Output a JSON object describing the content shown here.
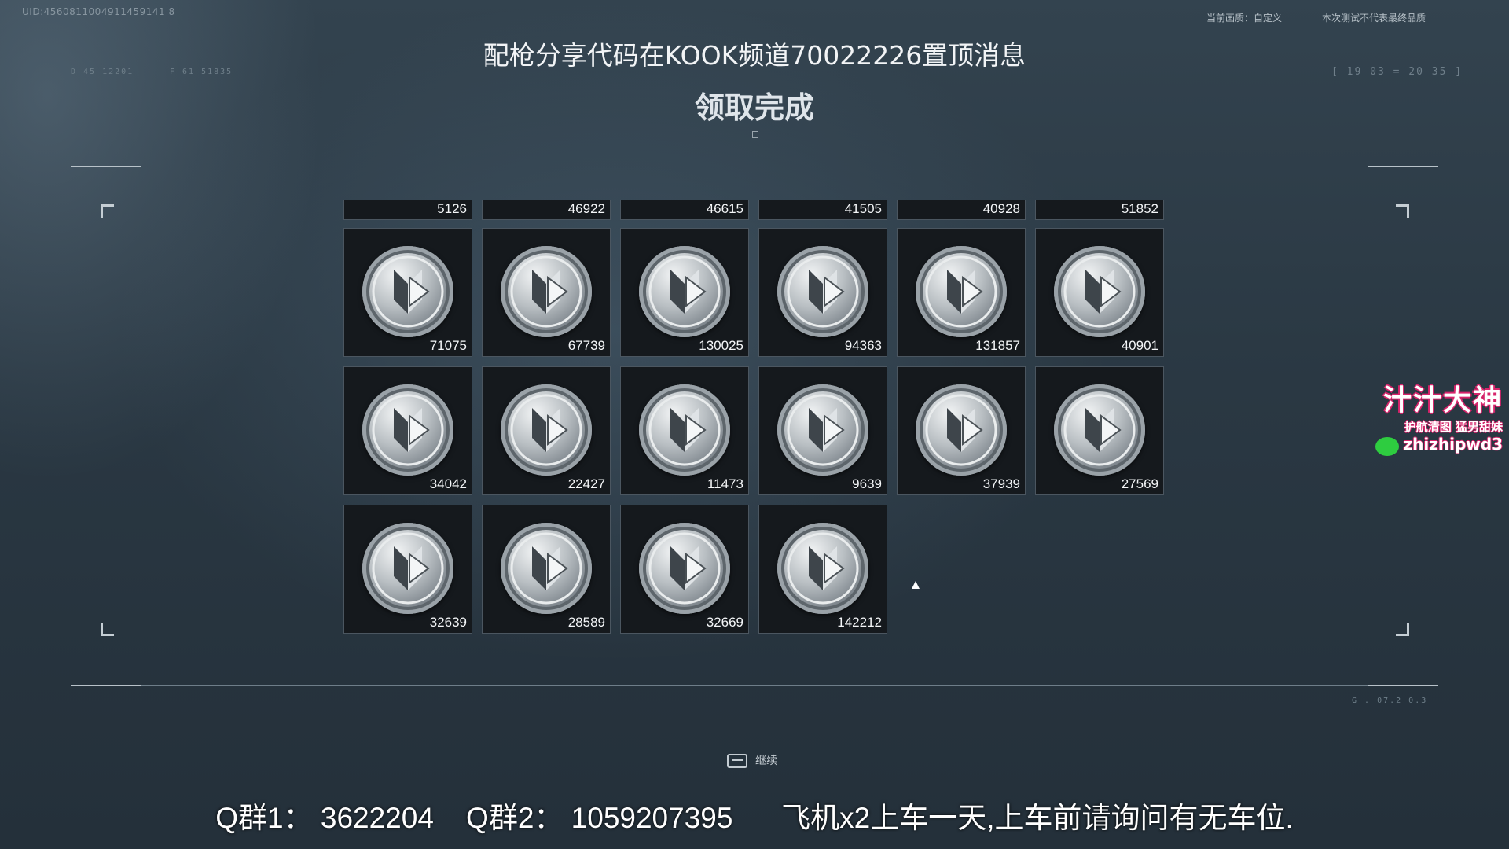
{
  "uid": "UID:4560811004911459141 8",
  "hud": {
    "top_left_a": "D 45  12201",
    "top_left_b": "F 61  51835",
    "top_right_bracket": "[ 19 03 = 20 35 ]",
    "bottom_right": "G  .  07.2     0.3"
  },
  "top_right": {
    "quality_label": "当前画质：自定义",
    "test_notice": "本次测试不代表最终品质"
  },
  "headline": "配枪分享代码在KOOK频道70022226置顶消息",
  "title": "领取完成",
  "stub_row": [
    "5126",
    "46922",
    "46615",
    "41505",
    "40928",
    "51852"
  ],
  "rows": [
    [
      "71075",
      "67739",
      "130025",
      "94363",
      "131857",
      "40901"
    ],
    [
      "34042",
      "22427",
      "11473",
      "9639",
      "37939",
      "27569"
    ],
    [
      "32639",
      "28589",
      "32669",
      "142212"
    ]
  ],
  "continue_label": "继续",
  "watermark": {
    "name": "汁汁大神",
    "tagline": "护航清图 猛男甜妹",
    "wechat_id": "zhizhipwd3"
  },
  "footer": "Q群1： 3622204    Q群2： 1059207395      飞机x2上车一天,上车前请询问有无车位.",
  "icons": {
    "coin": "silver-coin-icon",
    "continue_key": "keyboard-key-icon",
    "wechat": "wechat-icon"
  }
}
